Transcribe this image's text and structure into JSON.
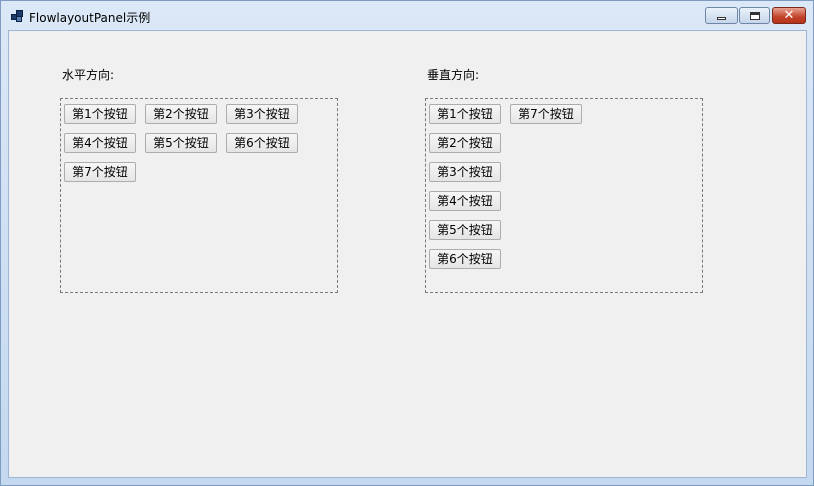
{
  "window": {
    "title": "FlowlayoutPanel示例",
    "close_glyph": "✕"
  },
  "horizontal": {
    "label": "水平方向:",
    "buttons": [
      "第1个按钮",
      "第2个按钮",
      "第3个按钮",
      "第4个按钮",
      "第5个按钮",
      "第6个按钮",
      "第7个按钮"
    ]
  },
  "vertical": {
    "label": "垂直方向:",
    "buttons": [
      "第1个按钮",
      "第2个按钮",
      "第3个按钮",
      "第4个按钮",
      "第5个按钮",
      "第6个按钮",
      "第7个按钮"
    ]
  },
  "colors": {
    "accent": "#c2432a",
    "client_bg": "#f0f0f0"
  }
}
